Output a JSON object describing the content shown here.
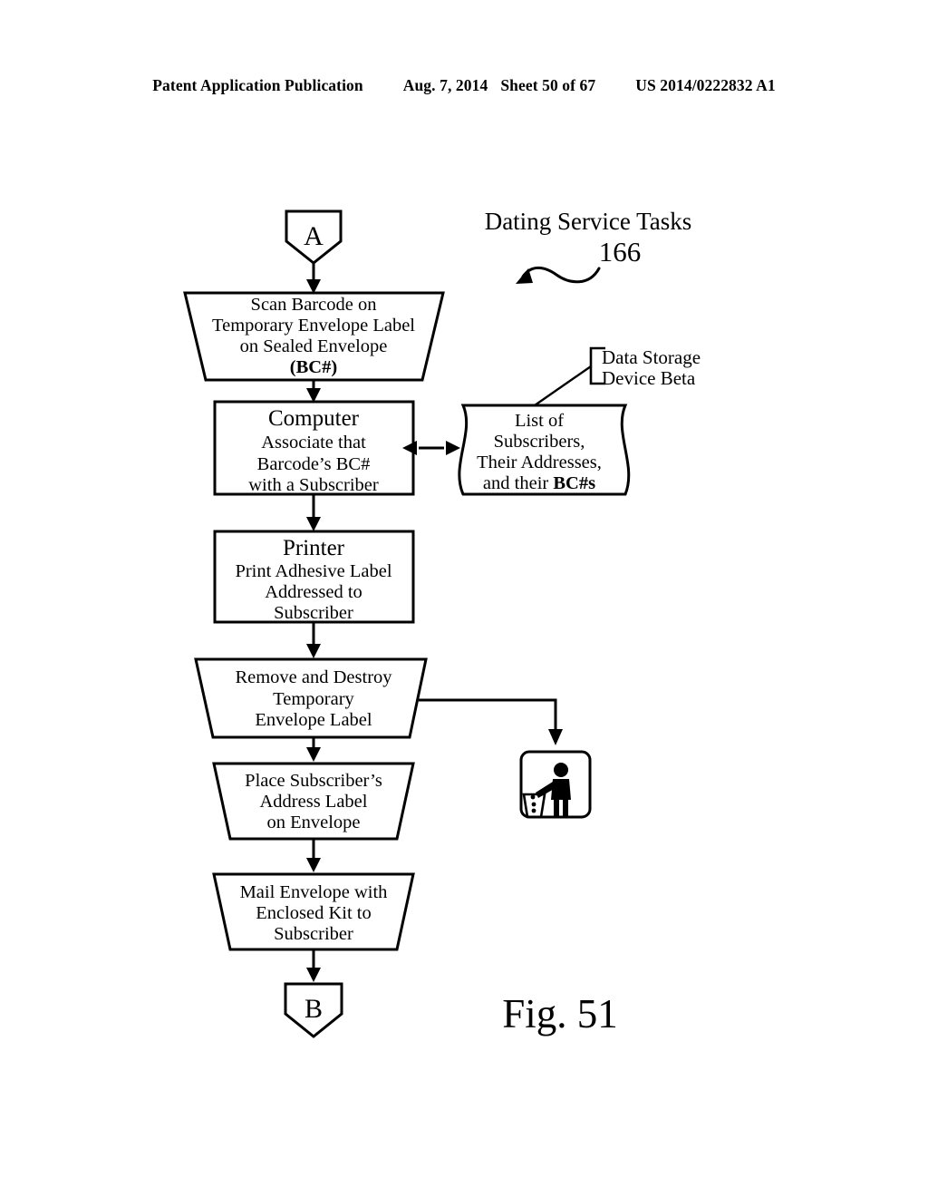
{
  "header": {
    "publication": "Patent Application Publication",
    "date": "Aug. 7, 2014",
    "sheet": "Sheet 50 of 67",
    "patent_number": "US 2014/0222832 A1"
  },
  "figure": {
    "caption": "Fig. 51",
    "title": "Dating Service Tasks",
    "reference_number": "166"
  },
  "connectors": {
    "entry_label": "A",
    "exit_label": "B"
  },
  "nodes": {
    "scan": {
      "shape": "trapezoid",
      "line1": "Scan Barcode on",
      "line2": "Temporary Envelope Label",
      "line3": "on Sealed Envelope",
      "line4": "(BC#)"
    },
    "computer": {
      "shape": "rectangle",
      "title": "Computer",
      "line1": "Associate that",
      "line2": "Barcode’s BC#",
      "line3": "with a Subscriber"
    },
    "database": {
      "shape": "data-document",
      "line1": "List of",
      "line2": "Subscribers,",
      "line3": "Their Addresses,",
      "line4_plain": "and their ",
      "line4_bold": "BC#s"
    },
    "storage_callout": {
      "line1": "Data Storage",
      "line2": "Device Beta"
    },
    "printer": {
      "shape": "rectangle",
      "title": "Printer",
      "line1": "Print Adhesive Label",
      "line2": "Addressed to",
      "line3": "Subscriber"
    },
    "remove": {
      "shape": "trapezoid",
      "line1": "Remove and Destroy",
      "line2": "Temporary",
      "line3": "Envelope Label"
    },
    "place": {
      "shape": "trapezoid",
      "line1": "Place Subscriber’s",
      "line2": "Address Label",
      "line3": "on Envelope"
    },
    "mail": {
      "shape": "trapezoid",
      "line1": "Mail Envelope with",
      "line2": "Enclosed Kit to",
      "line3": "Subscriber"
    },
    "trash": {
      "icon": "dispose-in-bin-icon"
    }
  },
  "colors": {
    "ink": "#000000",
    "paper": "#ffffff"
  }
}
